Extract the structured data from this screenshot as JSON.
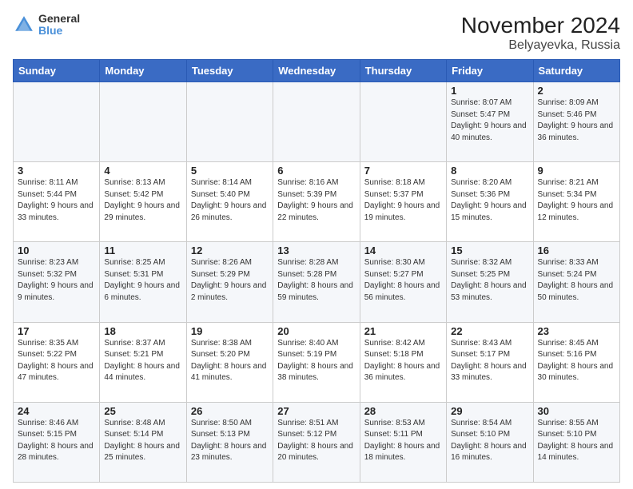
{
  "header": {
    "logo_line1": "General",
    "logo_line2": "Blue",
    "title": "November 2024",
    "subtitle": "Belyayevka, Russia"
  },
  "days_of_week": [
    "Sunday",
    "Monday",
    "Tuesday",
    "Wednesday",
    "Thursday",
    "Friday",
    "Saturday"
  ],
  "weeks": [
    [
      {
        "day": "",
        "info": ""
      },
      {
        "day": "",
        "info": ""
      },
      {
        "day": "",
        "info": ""
      },
      {
        "day": "",
        "info": ""
      },
      {
        "day": "",
        "info": ""
      },
      {
        "day": "1",
        "info": "Sunrise: 8:07 AM\nSunset: 5:47 PM\nDaylight: 9 hours and 40 minutes."
      },
      {
        "day": "2",
        "info": "Sunrise: 8:09 AM\nSunset: 5:46 PM\nDaylight: 9 hours and 36 minutes."
      }
    ],
    [
      {
        "day": "3",
        "info": "Sunrise: 8:11 AM\nSunset: 5:44 PM\nDaylight: 9 hours and 33 minutes."
      },
      {
        "day": "4",
        "info": "Sunrise: 8:13 AM\nSunset: 5:42 PM\nDaylight: 9 hours and 29 minutes."
      },
      {
        "day": "5",
        "info": "Sunrise: 8:14 AM\nSunset: 5:40 PM\nDaylight: 9 hours and 26 minutes."
      },
      {
        "day": "6",
        "info": "Sunrise: 8:16 AM\nSunset: 5:39 PM\nDaylight: 9 hours and 22 minutes."
      },
      {
        "day": "7",
        "info": "Sunrise: 8:18 AM\nSunset: 5:37 PM\nDaylight: 9 hours and 19 minutes."
      },
      {
        "day": "8",
        "info": "Sunrise: 8:20 AM\nSunset: 5:36 PM\nDaylight: 9 hours and 15 minutes."
      },
      {
        "day": "9",
        "info": "Sunrise: 8:21 AM\nSunset: 5:34 PM\nDaylight: 9 hours and 12 minutes."
      }
    ],
    [
      {
        "day": "10",
        "info": "Sunrise: 8:23 AM\nSunset: 5:32 PM\nDaylight: 9 hours and 9 minutes."
      },
      {
        "day": "11",
        "info": "Sunrise: 8:25 AM\nSunset: 5:31 PM\nDaylight: 9 hours and 6 minutes."
      },
      {
        "day": "12",
        "info": "Sunrise: 8:26 AM\nSunset: 5:29 PM\nDaylight: 9 hours and 2 minutes."
      },
      {
        "day": "13",
        "info": "Sunrise: 8:28 AM\nSunset: 5:28 PM\nDaylight: 8 hours and 59 minutes."
      },
      {
        "day": "14",
        "info": "Sunrise: 8:30 AM\nSunset: 5:27 PM\nDaylight: 8 hours and 56 minutes."
      },
      {
        "day": "15",
        "info": "Sunrise: 8:32 AM\nSunset: 5:25 PM\nDaylight: 8 hours and 53 minutes."
      },
      {
        "day": "16",
        "info": "Sunrise: 8:33 AM\nSunset: 5:24 PM\nDaylight: 8 hours and 50 minutes."
      }
    ],
    [
      {
        "day": "17",
        "info": "Sunrise: 8:35 AM\nSunset: 5:22 PM\nDaylight: 8 hours and 47 minutes."
      },
      {
        "day": "18",
        "info": "Sunrise: 8:37 AM\nSunset: 5:21 PM\nDaylight: 8 hours and 44 minutes."
      },
      {
        "day": "19",
        "info": "Sunrise: 8:38 AM\nSunset: 5:20 PM\nDaylight: 8 hours and 41 minutes."
      },
      {
        "day": "20",
        "info": "Sunrise: 8:40 AM\nSunset: 5:19 PM\nDaylight: 8 hours and 38 minutes."
      },
      {
        "day": "21",
        "info": "Sunrise: 8:42 AM\nSunset: 5:18 PM\nDaylight: 8 hours and 36 minutes."
      },
      {
        "day": "22",
        "info": "Sunrise: 8:43 AM\nSunset: 5:17 PM\nDaylight: 8 hours and 33 minutes."
      },
      {
        "day": "23",
        "info": "Sunrise: 8:45 AM\nSunset: 5:16 PM\nDaylight: 8 hours and 30 minutes."
      }
    ],
    [
      {
        "day": "24",
        "info": "Sunrise: 8:46 AM\nSunset: 5:15 PM\nDaylight: 8 hours and 28 minutes."
      },
      {
        "day": "25",
        "info": "Sunrise: 8:48 AM\nSunset: 5:14 PM\nDaylight: 8 hours and 25 minutes."
      },
      {
        "day": "26",
        "info": "Sunrise: 8:50 AM\nSunset: 5:13 PM\nDaylight: 8 hours and 23 minutes."
      },
      {
        "day": "27",
        "info": "Sunrise: 8:51 AM\nSunset: 5:12 PM\nDaylight: 8 hours and 20 minutes."
      },
      {
        "day": "28",
        "info": "Sunrise: 8:53 AM\nSunset: 5:11 PM\nDaylight: 8 hours and 18 minutes."
      },
      {
        "day": "29",
        "info": "Sunrise: 8:54 AM\nSunset: 5:10 PM\nDaylight: 8 hours and 16 minutes."
      },
      {
        "day": "30",
        "info": "Sunrise: 8:55 AM\nSunset: 5:10 PM\nDaylight: 8 hours and 14 minutes."
      }
    ]
  ]
}
